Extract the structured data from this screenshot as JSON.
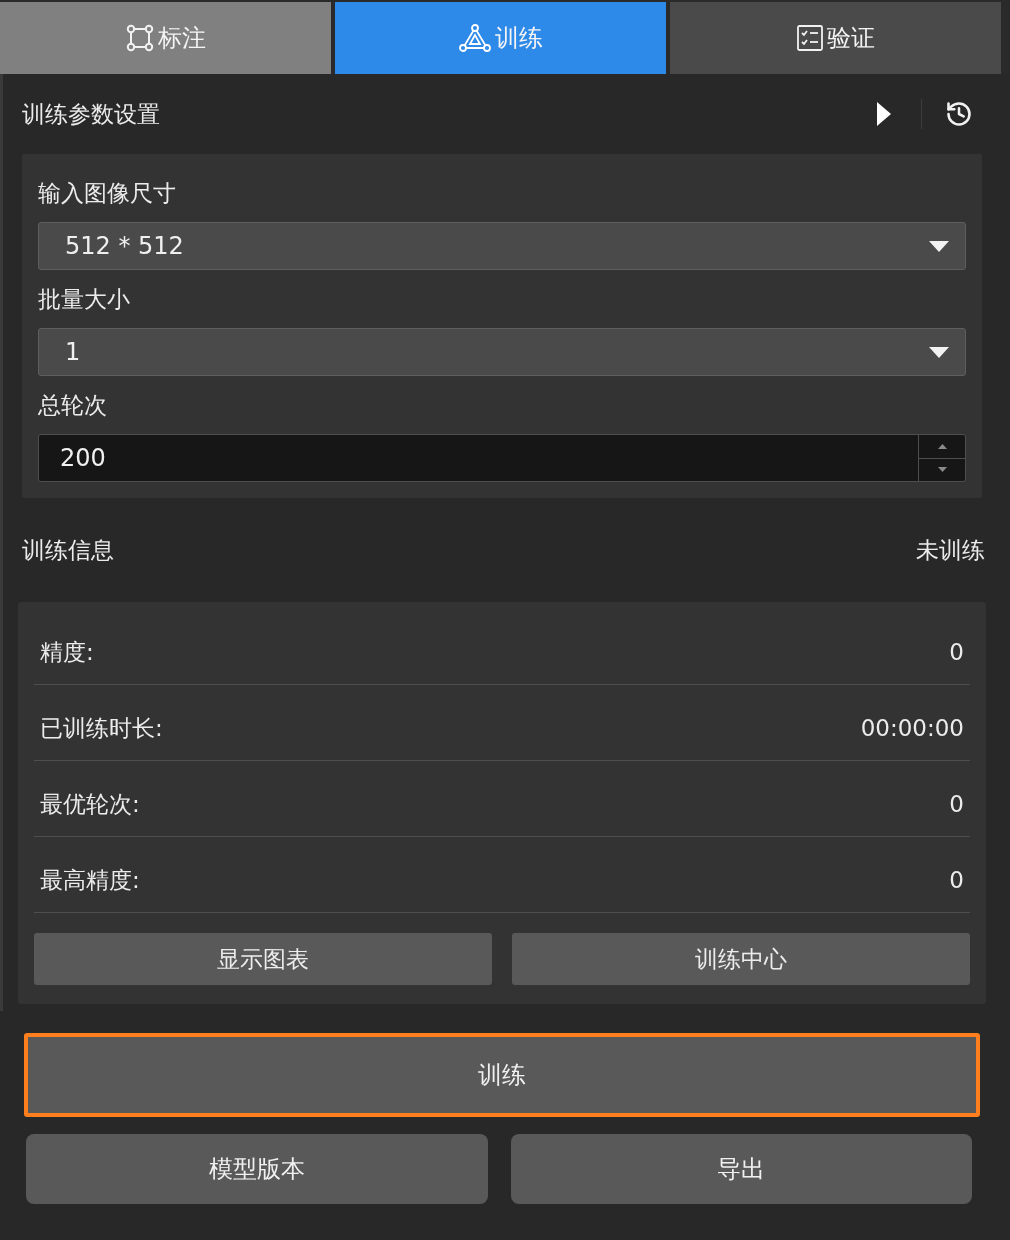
{
  "tabs": [
    {
      "label": "标注",
      "selected": false,
      "hovered": true
    },
    {
      "label": "训练",
      "selected": true,
      "hovered": false
    },
    {
      "label": "验证",
      "selected": false,
      "hovered": false
    }
  ],
  "training_params": {
    "title": "训练参数设置",
    "fields": [
      {
        "kind": "select",
        "label": "输入图像尺寸",
        "value": "512 * 512"
      },
      {
        "kind": "select",
        "label": "批量大小",
        "value": "1"
      },
      {
        "kind": "number",
        "label": "总轮次",
        "value": "200"
      }
    ]
  },
  "training_info": {
    "title": "训练信息",
    "status": "未训练",
    "rows": [
      {
        "label": "精度:",
        "value": "0"
      },
      {
        "label": "已训练时长:",
        "value": "00:00:00"
      },
      {
        "label": "最优轮次:",
        "value": "0"
      },
      {
        "label": "最高精度:",
        "value": "0"
      }
    ],
    "buttons": [
      "显示图表",
      "训练中心"
    ]
  },
  "train_button": {
    "label": "训练",
    "focused": true
  },
  "bottom_buttons": [
    "模型版本",
    "导出"
  ]
}
